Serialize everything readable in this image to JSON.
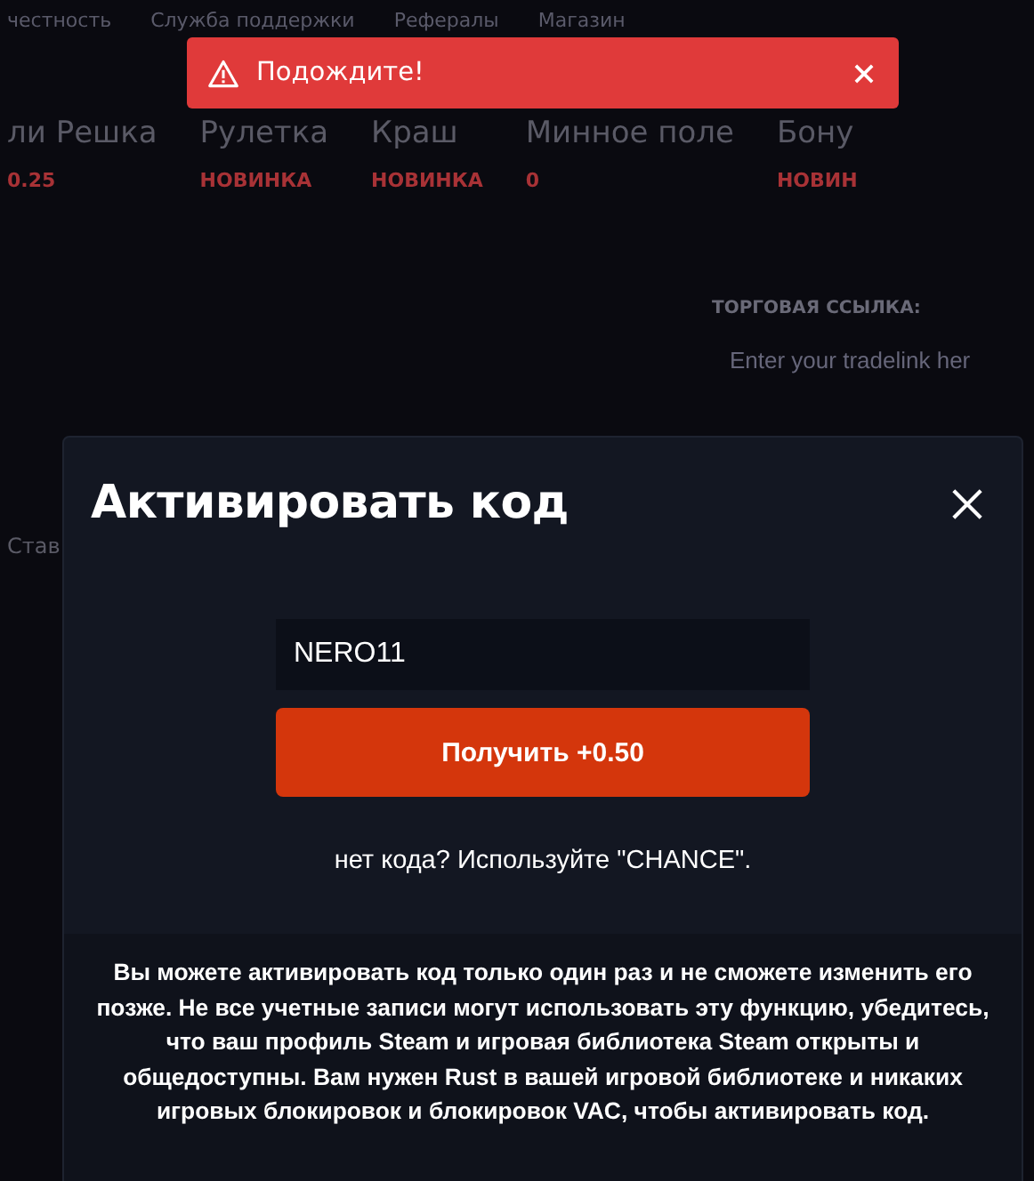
{
  "nav": [
    "честность",
    "Служба поддержки",
    "Рефералы",
    "Магазин"
  ],
  "games": [
    {
      "title": "ли Решка",
      "tag": "0.25"
    },
    {
      "title": "Рулетка",
      "tag": "НОВИНКА"
    },
    {
      "title": "Краш",
      "tag": "НОВИНКА"
    },
    {
      "title": "Минное поле",
      "tag": "0"
    },
    {
      "title": "Бону",
      "tag": "НОВИН"
    }
  ],
  "trade": {
    "label": "ТОРГОВАЯ ССЫЛКА:",
    "placeholder": "Enter your tradelink her"
  },
  "side_text": "Став",
  "toast": {
    "kind": "warning",
    "message": "Подождите!"
  },
  "modal": {
    "title": "Активировать код",
    "code": "NERO11",
    "button": "Получить +0.50",
    "hint": "нет кода? Используйте \"CHANCE\".",
    "info": "Вы можете активировать код только один раз и не сможете изменить его позже. Не все учетные записи могут использовать эту функцию, убедитесь, что ваш профиль Steam и игровая библиотека Steam открыты и общедоступны. Вам нужен Rust в вашей игровой библиотеке и никаких игровых блокировок и блокировок VAC, чтобы активировать код."
  }
}
